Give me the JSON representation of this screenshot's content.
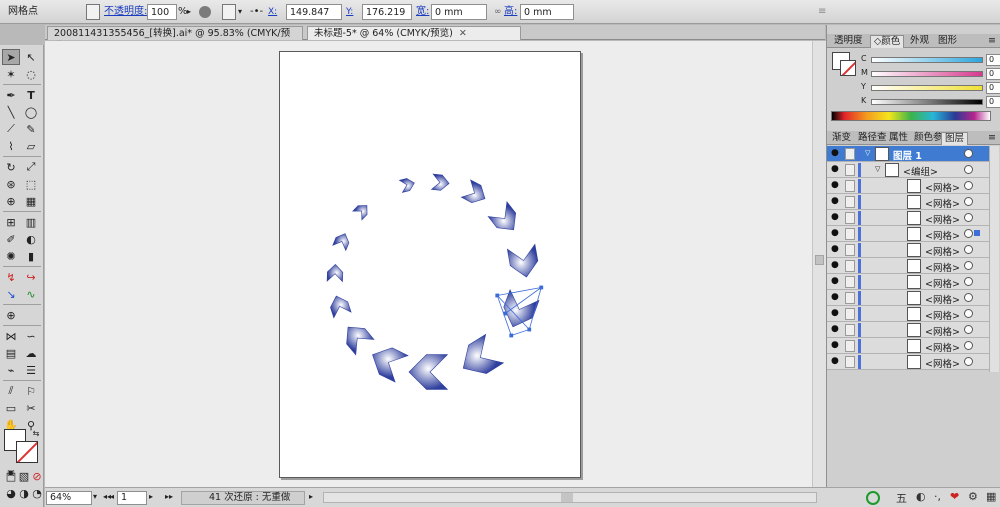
{
  "control_bar": {
    "tool_label": "网格点",
    "opacity_label": "不透明度:",
    "opacity_value": "100",
    "opacity_unit": "%",
    "x_label": "X:",
    "x_value": "149.847 mm",
    "y_label": "Y:",
    "y_value": "176.219 mm",
    "width_label": "宽:",
    "width_value": "0 mm",
    "height_label": "高:",
    "height_value": "0 mm"
  },
  "document_tabs": [
    {
      "label": "200811431355456_[转换].ai* @ 95.83% (CMYK/预览)",
      "active": false
    },
    {
      "label": "未标题-5* @ 64% (CMYK/预览)",
      "active": true
    }
  ],
  "tab_close_glyph": "✕",
  "color_panel": {
    "tabs": [
      "透明度",
      "◇颜色",
      "外观",
      "图形"
    ],
    "active_tab": 1,
    "channels": [
      {
        "label": "C",
        "value": "0",
        "color": "#2ba6de"
      },
      {
        "label": "M",
        "value": "0",
        "color": "#d63a8e"
      },
      {
        "label": "Y",
        "value": "0",
        "color": "#f0e034"
      },
      {
        "label": "K",
        "value": "0",
        "color": "#000000"
      }
    ],
    "percent_sign": "%"
  },
  "layers_panel": {
    "tabs": [
      "渐变",
      "路径查",
      "属性",
      "颜色参",
      "图层"
    ],
    "active_tab": 4,
    "layers": [
      {
        "label": "图层 1",
        "level": 0,
        "expanded": true,
        "selected": false
      },
      {
        "label": "<编组>",
        "level": 1,
        "expanded": true,
        "selected": false
      },
      {
        "label": "<网格>",
        "level": 2,
        "selected": false
      },
      {
        "label": "<网格>",
        "level": 2,
        "selected": false
      },
      {
        "label": "<网格>",
        "level": 2,
        "selected": false
      },
      {
        "label": "<网格>",
        "level": 2,
        "selected": true
      },
      {
        "label": "<网格>",
        "level": 2,
        "selected": false
      },
      {
        "label": "<网格>",
        "level": 2,
        "selected": false
      },
      {
        "label": "<网格>",
        "level": 2,
        "selected": false
      },
      {
        "label": "<网格>",
        "level": 2,
        "selected": false
      },
      {
        "label": "<网格>",
        "level": 2,
        "selected": false
      },
      {
        "label": "<网格>",
        "level": 2,
        "selected": false
      },
      {
        "label": "<网格>",
        "level": 2,
        "selected": false
      },
      {
        "label": "<网格>",
        "level": 2,
        "selected": false
      }
    ]
  },
  "status_bar": {
    "zoom": "64%",
    "artboard": "1",
    "message": "41 次还原 : 无重做"
  },
  "colors": {
    "shape_dark": "#2f3f9e",
    "shape_light": "#ffffff",
    "accent_blue": "#3f7bd1"
  },
  "icons": {
    "eye": "eye-icon",
    "expand": "disclosure-triangle-icon"
  }
}
